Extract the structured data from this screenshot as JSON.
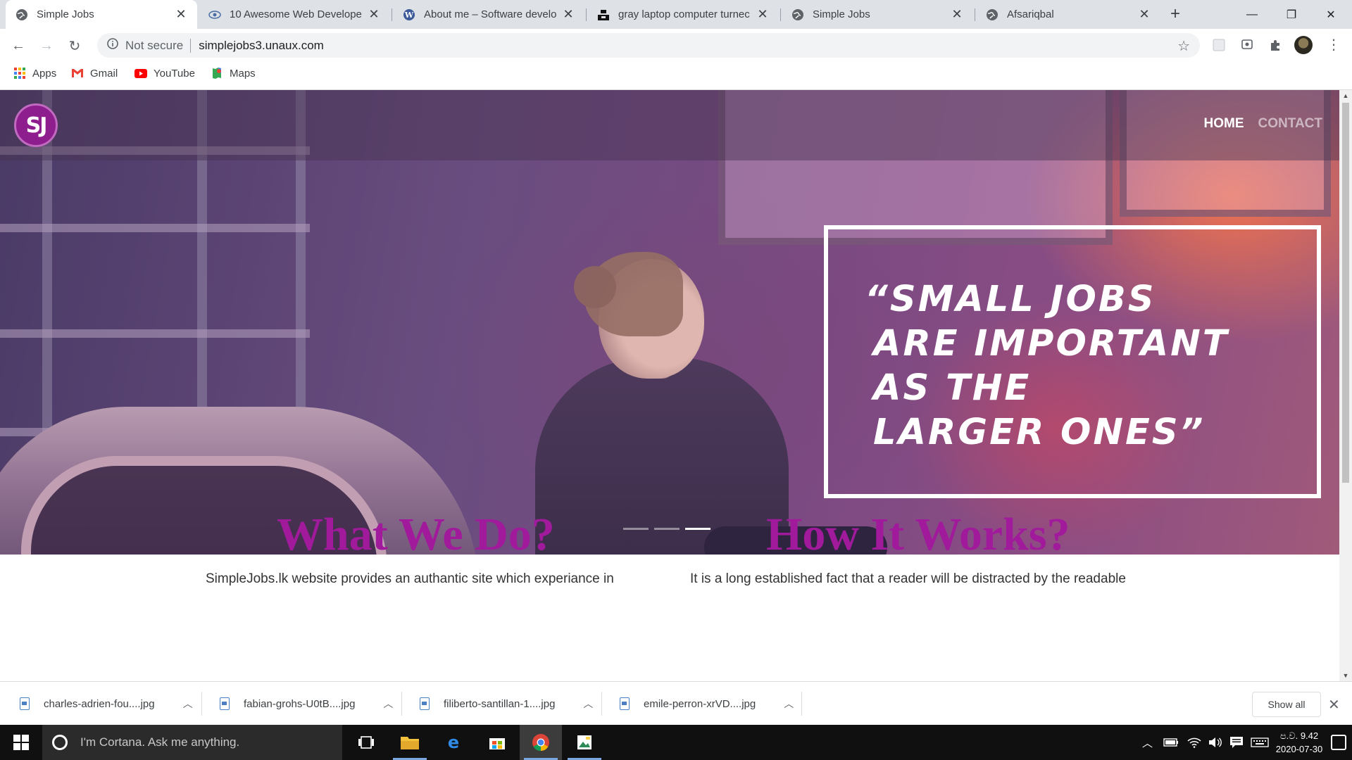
{
  "browser": {
    "tabs": [
      {
        "title": "Simple Jobs",
        "active": true
      },
      {
        "title": "10 Awesome Web Developer",
        "active": false
      },
      {
        "title": "About me – Software develo",
        "active": false
      },
      {
        "title": "gray laptop computer turnec",
        "active": false
      },
      {
        "title": "Simple Jobs",
        "active": false
      },
      {
        "title": "Afsariqbal",
        "active": false
      }
    ],
    "new_tab": "+",
    "window_buttons": {
      "minimize": "—",
      "restore": "❐",
      "close": "✕"
    },
    "address": {
      "security_label": "Not secure",
      "url": "simplejobs3.unaux.com"
    },
    "bookmarks": [
      {
        "label": "Apps",
        "icon": "apps-grid-icon"
      },
      {
        "label": "Gmail",
        "icon": "gmail-icon"
      },
      {
        "label": "YouTube",
        "icon": "youtube-icon"
      },
      {
        "label": "Maps",
        "icon": "maps-icon"
      }
    ]
  },
  "site": {
    "logo_text": "SJ",
    "nav": [
      {
        "label": "HOME",
        "active": true
      },
      {
        "label": "CONTACT",
        "active": false
      }
    ],
    "hero": {
      "quote_lines": [
        "“SMALL JOBS",
        "ARE IMPORTANT",
        "AS THE",
        "LARGER ONES”"
      ],
      "slides": 3,
      "active_slide": 3
    },
    "sections": {
      "what": {
        "title": "What We Do?",
        "text": "SimpleJobs.lk website provides an authantic site which experiance in"
      },
      "how": {
        "title": "How It Works?",
        "text": "It is a long established fact that a reader will be distracted by the readable"
      }
    },
    "accent_color": "#a11a9c"
  },
  "downloads": {
    "items": [
      {
        "name": "charles-adrien-fou....jpg"
      },
      {
        "name": "fabian-grohs-U0tB....jpg"
      },
      {
        "name": "filiberto-santillan-1....jpg"
      },
      {
        "name": "emile-perron-xrVD....jpg"
      }
    ],
    "show_all": "Show all"
  },
  "taskbar": {
    "search_placeholder": "I'm Cortana. Ask me anything.",
    "clock_time": "ප.ව. 9.42",
    "clock_date": "2020-07-30"
  }
}
